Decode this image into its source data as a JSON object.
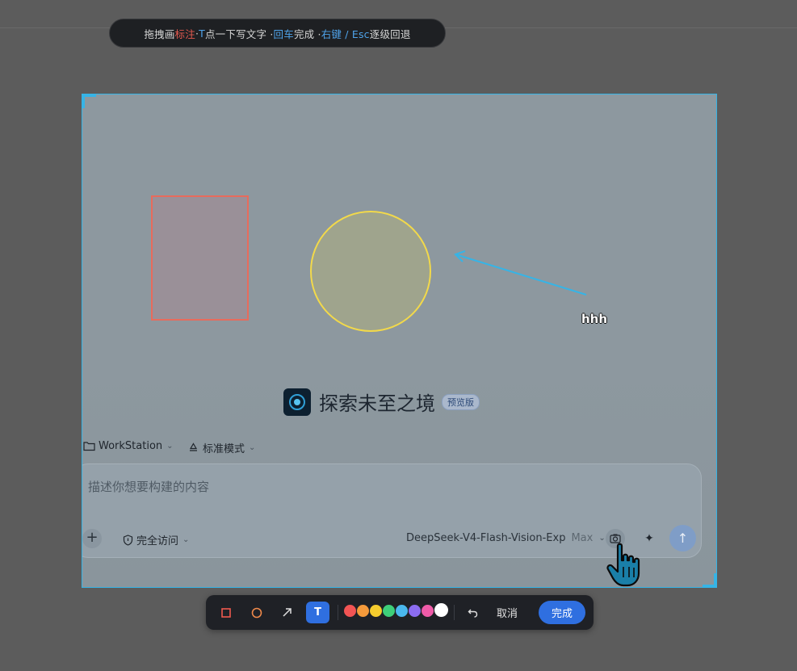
{
  "hint": {
    "drag": "拖拽画",
    "annotate": "标注",
    "dot1": " · ",
    "t_key": "T",
    "t_desc": " 点一下写文字 · ",
    "enter_key": "回车",
    "enter_desc": " 完成 · ",
    "right_key": "右键 / Esc",
    "right_desc": " 逐级回退"
  },
  "annotations": {
    "text_label": "hhh",
    "colors": {
      "rect": "#e86b5c",
      "circle": "#f2d94a",
      "arrow": "#36b4e6"
    }
  },
  "brand": {
    "title": "探索未至之境",
    "badge": "预览版"
  },
  "options": {
    "workspace": "WorkStation",
    "mode": "标准模式"
  },
  "composer": {
    "placeholder": "描述你想要构建的内容",
    "access": "完全访问",
    "model": "DeepSeek-V4-Flash-Vision-Exp",
    "model_tier": "Max"
  },
  "toolbar": {
    "tools": [
      "rectangle",
      "ellipse",
      "arrow",
      "text"
    ],
    "active_tool": "text",
    "colors": [
      "#f25454",
      "#f59a3b",
      "#f5cc2e",
      "#3ecf7a",
      "#4ab8ee",
      "#8b6cf0",
      "#ef5ba8",
      "#ffffff"
    ],
    "selected_color": "#ffffff",
    "cancel_label": "取消",
    "done_label": "完成"
  }
}
